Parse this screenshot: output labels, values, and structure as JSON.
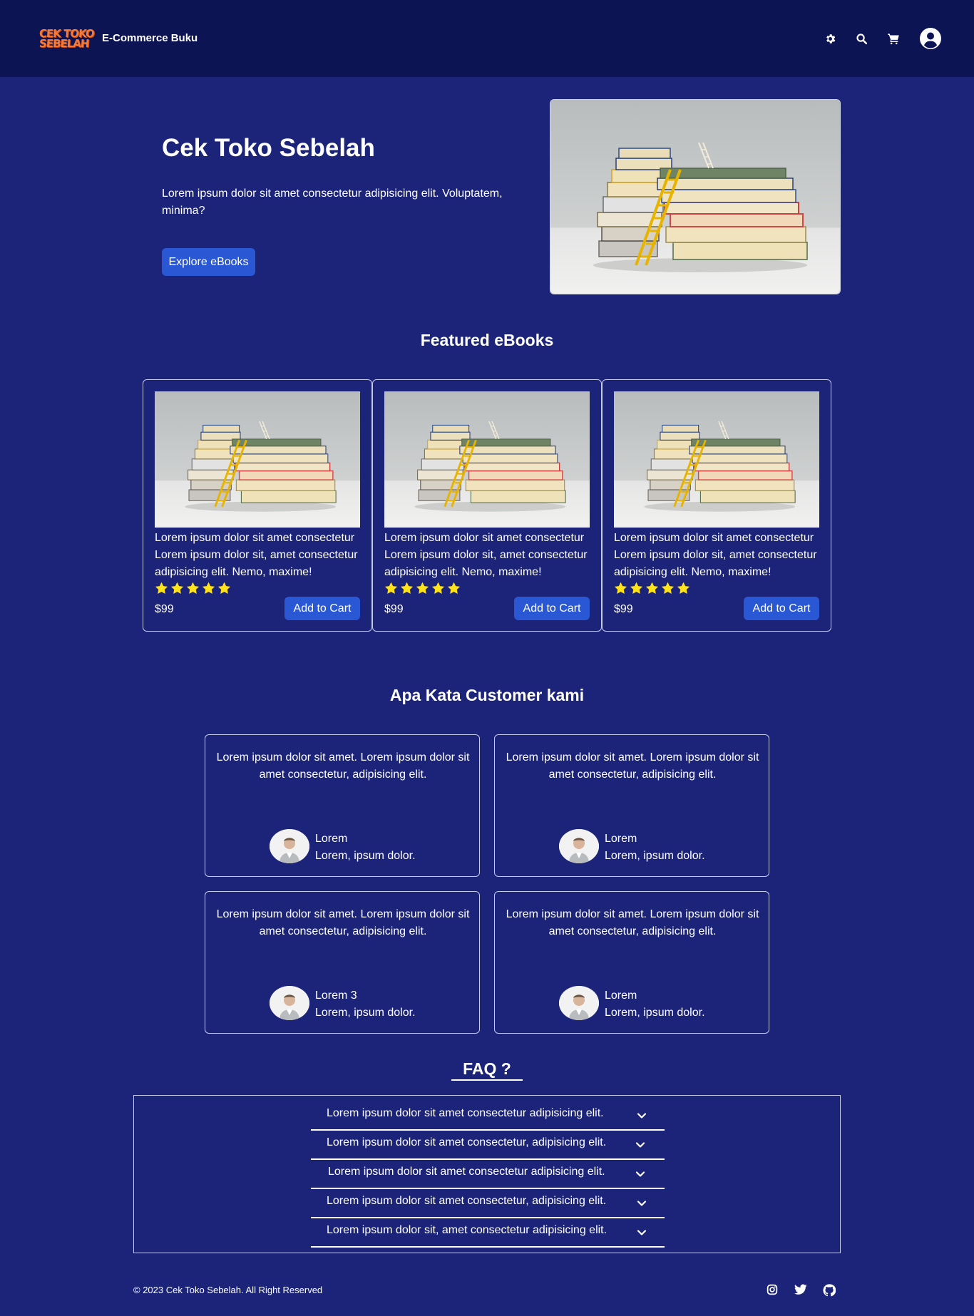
{
  "navbar": {
    "logo_line1": "CEK TOKO",
    "logo_line2": "SEBELAH",
    "brand": "E-Commerce Buku",
    "icons": [
      "gear-icon",
      "search-icon",
      "cart-icon",
      "user-circle-icon"
    ]
  },
  "hero": {
    "title": "Cek Toko Sebelah",
    "description": "Lorem ipsum dolor sit amet consectetur adipisicing elit. Voluptatem, minima?",
    "button": "Explore eBooks"
  },
  "featured": {
    "title": "Featured eBooks",
    "items": [
      {
        "description": "Lorem ipsum dolor sit amet consectetur Lorem ipsum dolor sit, amet consectetur adipisicing elit. Nemo, maxime!",
        "rating": 5,
        "price": "$99",
        "button": "Add to Cart"
      },
      {
        "description": "Lorem ipsum dolor sit amet consectetur Lorem ipsum dolor sit, amet consectetur adipisicing elit. Nemo, maxime!",
        "rating": 5,
        "price": "$99",
        "button": "Add to Cart"
      },
      {
        "description": "Lorem ipsum dolor sit amet consectetur Lorem ipsum dolor sit, amet consectetur adipisicing elit. Nemo, maxime!",
        "rating": 5,
        "price": "$99",
        "button": "Add to Cart"
      }
    ]
  },
  "testimonials": {
    "title": "Apa Kata Customer kami",
    "items": [
      {
        "quote": "Lorem ipsum dolor sit amet. Lorem ipsum dolor sit amet consectetur, adipisicing elit.",
        "name": "Lorem",
        "role": "Lorem, ipsum dolor."
      },
      {
        "quote": "Lorem ipsum dolor sit amet. Lorem ipsum dolor sit amet consectetur, adipisicing elit.",
        "name": "Lorem",
        "role": "Lorem, ipsum dolor."
      },
      {
        "quote": "Lorem ipsum dolor sit amet. Lorem ipsum dolor sit amet consectetur, adipisicing elit.",
        "name": "Lorem 3",
        "role": "Lorem, ipsum dolor."
      },
      {
        "quote": "Lorem ipsum dolor sit amet. Lorem ipsum dolor sit amet consectetur, adipisicing elit.",
        "name": "Lorem",
        "role": "Lorem, ipsum dolor."
      }
    ]
  },
  "faq": {
    "title": "FAQ ?",
    "items": [
      "Lorem ipsum dolor sit amet consectetur adipisicing elit.",
      "Lorem ipsum dolor sit amet consectetur, adipisicing elit.",
      "Lorem ipsum dolor sit amet consectetur adipisicing elit.",
      "Lorem ipsum dolor sit amet consectetur, adipisicing elit.",
      "Lorem ipsum dolor sit, amet consectetur adipisicing elit."
    ]
  },
  "footer": {
    "copyright": "© 2023 Cek Toko Sebelah. All Right Reserved",
    "social": [
      "instagram-icon",
      "twitter-icon",
      "github-icon"
    ]
  },
  "colors": {
    "page_bg": "#1c247a",
    "navbar_bg": "#0c1454",
    "button": "#2a58d4",
    "star": "#ffe21a",
    "logo": "#f47a3a"
  }
}
